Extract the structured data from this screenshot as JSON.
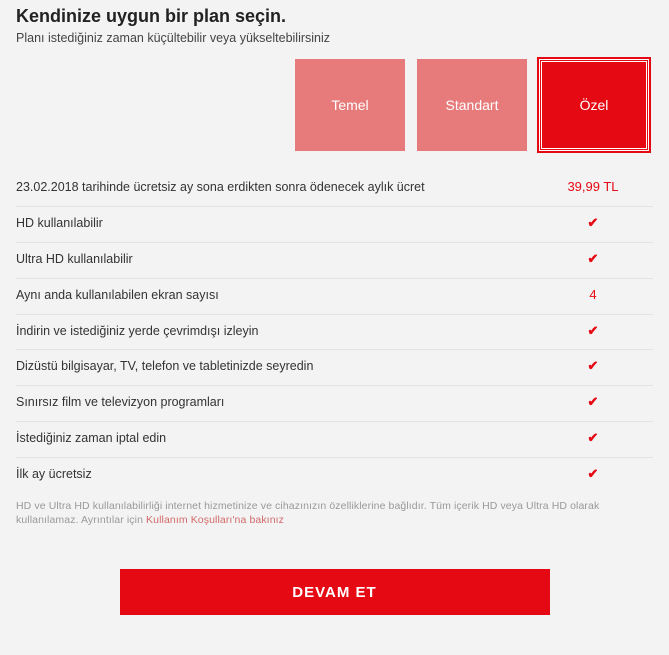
{
  "title": "Kendinize uygun bir plan seçin.",
  "subtitle": "Planı istediğiniz zaman küçültebilir veya yükseltebilirsiniz",
  "plans": {
    "basic": "Temel",
    "standard": "Standart",
    "premium": "Özel"
  },
  "rows": {
    "price_label": "23.02.2018 tarihinde ücretsiz ay sona erdikten sonra ödenecek aylık ücret",
    "price_value": "39,99 TL",
    "hd_label": "HD kullanılabilir",
    "uhd_label": "Ultra HD kullanılabilir",
    "screens_label": "Aynı anda kullanılabilen ekran sayısı",
    "screens_value": "4",
    "download_label": "İndirin ve istediğiniz yerde çevrimdışı izleyin",
    "devices_label": "Dizüstü bilgisayar, TV, telefon ve tabletinizde seyredin",
    "unlimited_label": "Sınırsız film ve televizyon programları",
    "cancel_label": "İstediğiniz zaman iptal edin",
    "freemonth_label": "İlk ay ücretsiz"
  },
  "fineprint_text": "HD ve Ultra HD kullanılabilirliği internet hizmetinize ve cihazınızın özelliklerine bağlıdır. Tüm içerik HD veya Ultra HD olarak kullanılamaz. Ayrıntılar için ",
  "fineprint_link": "Kullanım Koşulları'na bakınız",
  "continue": "DEVAM ET"
}
